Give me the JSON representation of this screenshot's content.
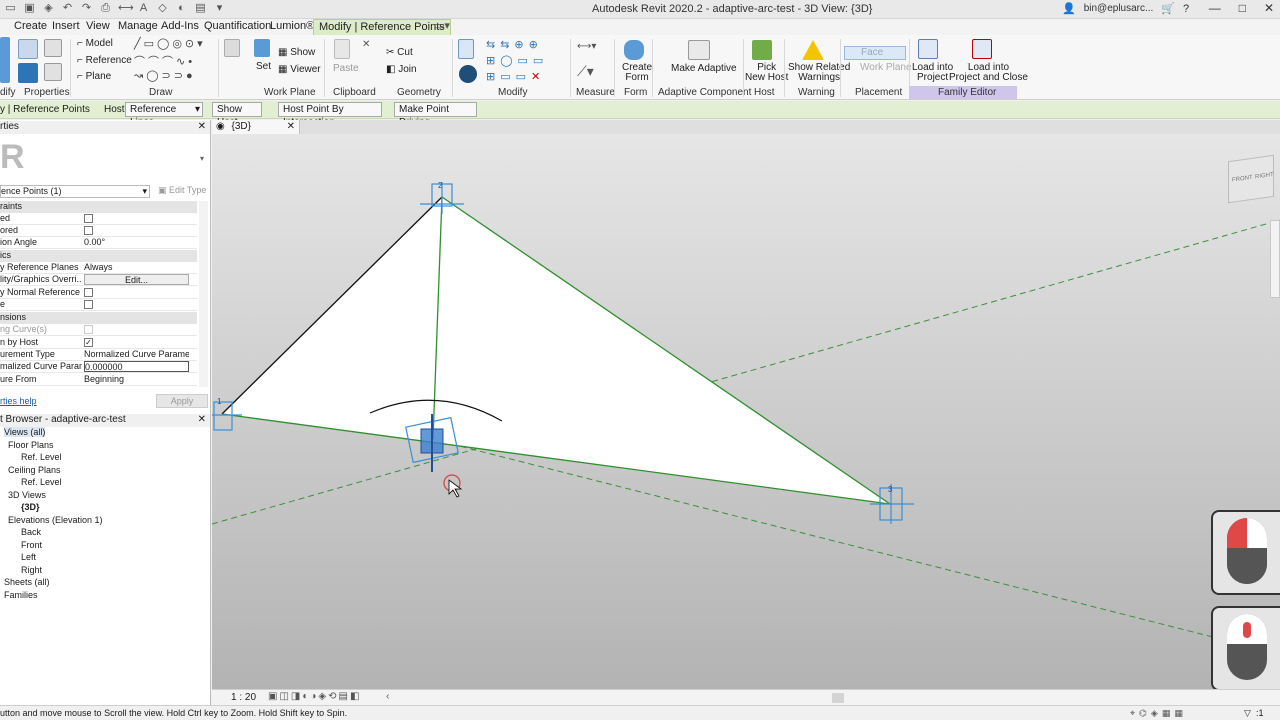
{
  "titlebar": {
    "title": "Autodesk Revit 2020.2 - adaptive-arc-test - 3D View: {3D}",
    "user": "bin@eplusarc...",
    "win_min": "—",
    "win_max": "□",
    "win_close": "✕"
  },
  "tabs": [
    {
      "label": "Create"
    },
    {
      "label": "Insert"
    },
    {
      "label": "View"
    },
    {
      "label": "Manage"
    },
    {
      "label": "Add-Ins"
    },
    {
      "label": "Quantification"
    },
    {
      "label": "Lumion®"
    },
    {
      "label": "Modify | Reference Points"
    }
  ],
  "ribbon": {
    "draw": {
      "model": "Model",
      "reference": "Reference",
      "plane": "Plane"
    },
    "workplane": {
      "set": "Set",
      "show": "Show",
      "viewer": "Viewer"
    },
    "clipboard": {
      "paste": "Paste",
      "cut": "Cut",
      "join": "Join"
    },
    "form": {
      "create_form_1": "Create",
      "create_form_2": "Form"
    },
    "adaptive": {
      "make_1": "Make Adaptive"
    },
    "host": {
      "pick_1": "Pick",
      "pick_2": "New Host"
    },
    "warning": {
      "show_1": "Show Related",
      "show_2": "Warnings"
    },
    "placement": {
      "face": "Face",
      "workplane": "Work Plane"
    },
    "family": {
      "load_1": "Load into",
      "load_2": "Project",
      "loadclose_1": "Load into",
      "loadclose_2": "Project and Close"
    },
    "panels": {
      "properties": "Properties",
      "draw": "Draw",
      "workplane": "Work Plane",
      "clipboard": "Clipboard",
      "geometry": "Geometry",
      "modify": "Modify",
      "measure": "Measure",
      "form": "Form",
      "adaptive": "Adaptive Component",
      "host": "Host",
      "warning": "Warning",
      "placement": "Placement",
      "family": "Family Editor"
    },
    "modify_short": "dify"
  },
  "optbar": {
    "context": "y | Reference Points",
    "host_label": "Host:",
    "host_value": "Reference Lines",
    "show_host": "Show Host",
    "host_point": "Host Point By Intersection",
    "make_driving": "Make Point Driving..."
  },
  "properties": {
    "header": "rties",
    "type_selector": "ence Points (1)",
    "edit_type": "Edit Type",
    "groups": [
      "raints",
      "ics",
      "nsions"
    ],
    "rows": [
      {
        "k": "ed",
        "v": ""
      },
      {
        "k": "ored",
        "v": ""
      },
      {
        "k": "ion Angle",
        "v": "0.00°"
      },
      {
        "k": "y Reference Planes",
        "v": "Always"
      },
      {
        "k": "lity/Graphics Overri...",
        "v": "Edit..."
      },
      {
        "k": "y Normal Reference ...",
        "v": ""
      },
      {
        "k": "e",
        "v": ""
      },
      {
        "k": "ng Curve(s)",
        "v": ""
      },
      {
        "k": "n by Host",
        "v": "✓"
      },
      {
        "k": "urement Type",
        "v": "Normalized Curve Parame..."
      },
      {
        "k": "malized Curve Param...",
        "v": "0.000000"
      },
      {
        "k": "ure From",
        "v": "Beginning"
      }
    ],
    "help": "rties help",
    "apply": "Apply"
  },
  "browser": {
    "header": "t Browser - adaptive-arc-test",
    "items": [
      {
        "label": "Views (all)",
        "indent": 0
      },
      {
        "label": "Floor Plans",
        "indent": 1
      },
      {
        "label": "Ref. Level",
        "indent": 2
      },
      {
        "label": "Ceiling Plans",
        "indent": 1
      },
      {
        "label": "Ref. Level",
        "indent": 2
      },
      {
        "label": "3D Views",
        "indent": 1
      },
      {
        "label": "{3D}",
        "indent": 2
      },
      {
        "label": "Elevations (Elevation 1)",
        "indent": 1
      },
      {
        "label": "Back",
        "indent": 2
      },
      {
        "label": "Front",
        "indent": 2
      },
      {
        "label": "Left",
        "indent": 2
      },
      {
        "label": "Right",
        "indent": 2
      },
      {
        "label": "Sheets (all)",
        "indent": 0
      },
      {
        "label": "Families",
        "indent": 0
      }
    ]
  },
  "viewtab": {
    "label": "{3D}"
  },
  "viewcube": {
    "front": "FRONT",
    "right": "RIGHT"
  },
  "viewbar": {
    "scale": "1 : 20"
  },
  "statusbar": {
    "text": "utton and move mouse to Scroll the view. Hold Ctrl key to Zoom. Hold Shift key to Spin.",
    "zoom": ":1"
  },
  "points": {
    "p1": "1",
    "p2": "2",
    "p3": "3"
  }
}
